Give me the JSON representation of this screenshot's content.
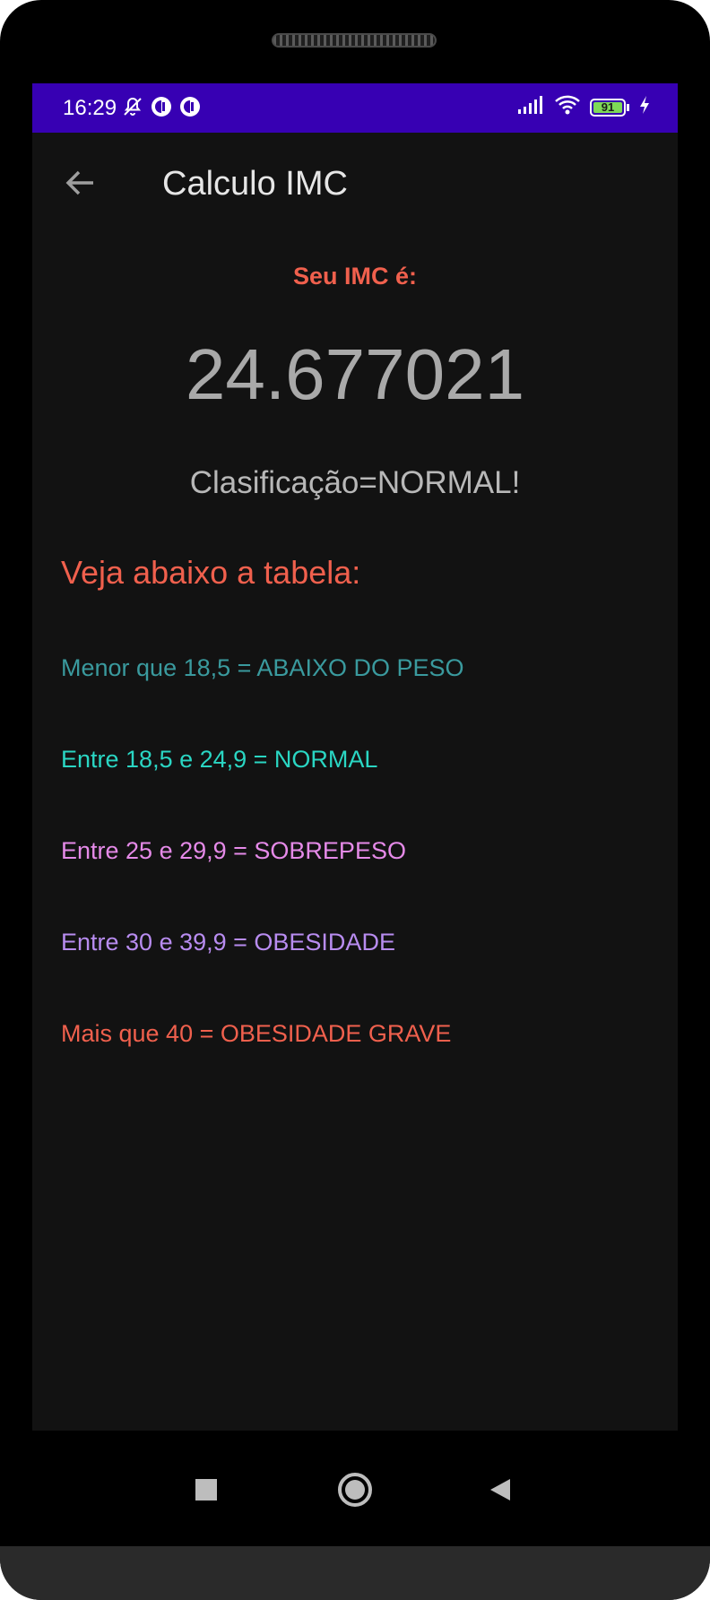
{
  "status_bar": {
    "time": "16:29",
    "battery_level": "91",
    "background_color": "#3700b3",
    "icons_left": [
      "notifications-off-icon",
      "app-notification-icon",
      "app-notification-icon"
    ],
    "icons_right": [
      "signal-icon",
      "wifi-icon",
      "battery-icon",
      "charging-icon"
    ]
  },
  "app_bar": {
    "title": "Calculo IMC",
    "back_icon": "arrow-back-icon"
  },
  "result": {
    "label": "Seu IMC é:",
    "value": "24.677021",
    "classification": "Clasificação=NORMAL!"
  },
  "table": {
    "heading": "Veja abaixo a tabela:",
    "rows": [
      {
        "text": "Menor que 18,5 = ABAIXO DO PESO",
        "color": "#3a9a9e"
      },
      {
        "text": "Entre 18,5 e 24,9 = NORMAL",
        "color": "#2ad6c3"
      },
      {
        "text": "Entre 25 e 29,9 = SOBREPESO",
        "color": "#e58ae8"
      },
      {
        "text": "Entre 30 e 39,9 = OBESIDADE",
        "color": "#b88cf0"
      },
      {
        "text": "Mais que 40 = OBESIDADE GRAVE",
        "color": "#f0604d"
      }
    ]
  },
  "colors": {
    "accent_red": "#f0604d",
    "screen_background": "#121212"
  },
  "nav_bar": {
    "buttons": [
      "recent-apps-icon",
      "home-icon",
      "back-icon"
    ]
  }
}
